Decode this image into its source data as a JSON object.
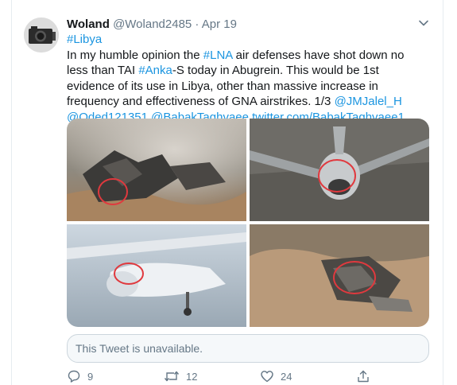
{
  "tweet": {
    "author_name": "Woland",
    "handle": "@Woland2485",
    "separator": "·",
    "date": "Apr 19",
    "hashtag_line": "#Libya",
    "text": {
      "p1": "In my humble opinion the ",
      "lna": "#LNA",
      "p2": " air defenses have shot down no less than TAI ",
      "anka": "#Anka",
      "p3": "-S today in Abugrein. This would be 1st evidence of its use in Libya, other than massive increase in frequency and effectiveness of GNA airstrikes. 1/3 ",
      "m1": "@JMJalel_H",
      "m2": "@Oded121351",
      "m3": "@BabakTaghvaee",
      "url": "twitter.com/BabakTaghvaee1..."
    },
    "quoted_unavailable": "This Tweet is unavailable.",
    "counts": {
      "replies": "9",
      "retweets": "12",
      "likes": "24"
    },
    "icons": {
      "caret": "chevron-down-icon",
      "reply": "reply-icon",
      "retweet": "retweet-icon",
      "like": "heart-icon",
      "share": "share-icon"
    }
  },
  "colors": {
    "link": "#1b95e0",
    "muted": "#657786",
    "border": "#ccd6dd",
    "annotation": "#e0393e"
  }
}
